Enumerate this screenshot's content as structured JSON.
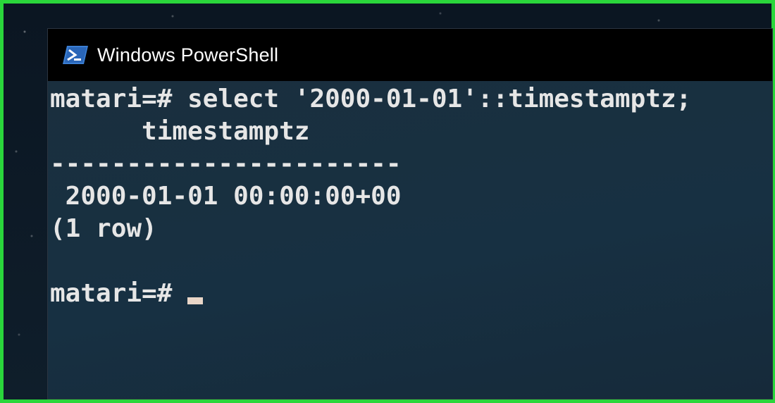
{
  "window": {
    "title": "Windows PowerShell",
    "icon": "powershell-icon"
  },
  "terminal": {
    "lines": [
      "matari=# select '2000-01-01'::timestamptz;",
      "      timestamptz",
      "-----------------------",
      " 2000-01-01 00:00:00+00",
      "(1 row)",
      "",
      "matari=# "
    ]
  },
  "colors": {
    "frame_border": "#2ad63b",
    "terminal_bg": "#1a2f3e",
    "text": "#e6e6e6",
    "cursor": "#e9d6c8"
  }
}
